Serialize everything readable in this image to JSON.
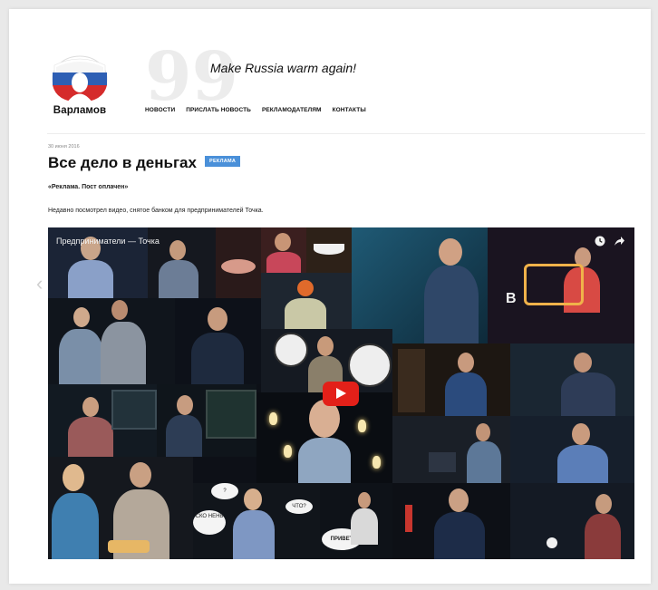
{
  "site": {
    "logo_text": "Варламов",
    "slogan": "Make Russia warm again!",
    "quote_mark": "99",
    "nav": [
      "НОВОСТИ",
      "ПРИСЛАТЬ НОВОСТЬ",
      "РЕКЛАМОДАТЕЛЯМ",
      "КОНТАКТЫ"
    ]
  },
  "post": {
    "date": "30 июня 2016",
    "title": "Все дело в деньгах",
    "badge": "РЕКЛАМА",
    "subtitle": "«Реклама. Пост оплачен»",
    "lead": "Недавно посмотрел видео, снятое банком для предпринимателей Точка."
  },
  "video": {
    "title": "Предприниматели — Точка",
    "bubbles": [
      "ЧТО?",
      "СКО НЕНЬ",
      "ПРИВЕТ",
      "?"
    ],
    "icons": {
      "watch_later": "clock-icon",
      "share": "share-icon",
      "play": "play-icon",
      "prev": "chevron-left-icon"
    },
    "letter": "B"
  },
  "colors": {
    "badge": "#4a90d9",
    "play": "#e32019",
    "video_bg": "#0d1017"
  }
}
